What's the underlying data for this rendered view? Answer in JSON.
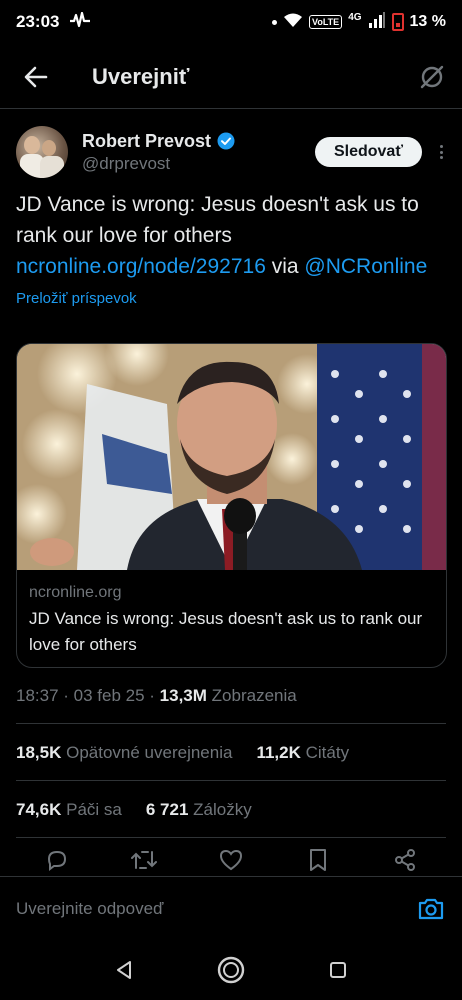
{
  "status_bar": {
    "time": "23:03",
    "network": "4G",
    "volte": "VoLTE",
    "battery": "13 %"
  },
  "header": {
    "title": "Uverejniť"
  },
  "author": {
    "name": "Robert Prevost",
    "handle": "@drprevost",
    "follow_label": "Sledovať"
  },
  "tweet": {
    "text_plain": "JD Vance is wrong: Jesus doesn't ask us to rank our love for others ",
    "link_url": "ncronline.org/node/292716",
    "via": " via ",
    "mention": "@NCRonline",
    "translate_label": "Preložiť príspevok"
  },
  "card": {
    "domain": "ncronline.org",
    "title": "JD Vance is wrong: Jesus doesn't ask us to rank our love for others"
  },
  "meta": {
    "time": "18:37",
    "date": "03 feb 25",
    "views_count": "13,3M",
    "views_label": "Zobrazenia"
  },
  "stats": {
    "reposts_count": "18,5K",
    "reposts_label": "Opätovné uverejnenia",
    "quotes_count": "11,2K",
    "quotes_label": "Citáty",
    "likes_count": "74,6K",
    "likes_label": "Páči sa",
    "bookmarks_count": "6 721",
    "bookmarks_label": "Záložky"
  },
  "reply": {
    "placeholder": "Uverejnite odpoveď"
  },
  "colors": {
    "accent": "#1d9bf0",
    "background": "#000000",
    "muted": "#71767b",
    "text": "#e7e9ea",
    "divider": "#2f3336"
  }
}
